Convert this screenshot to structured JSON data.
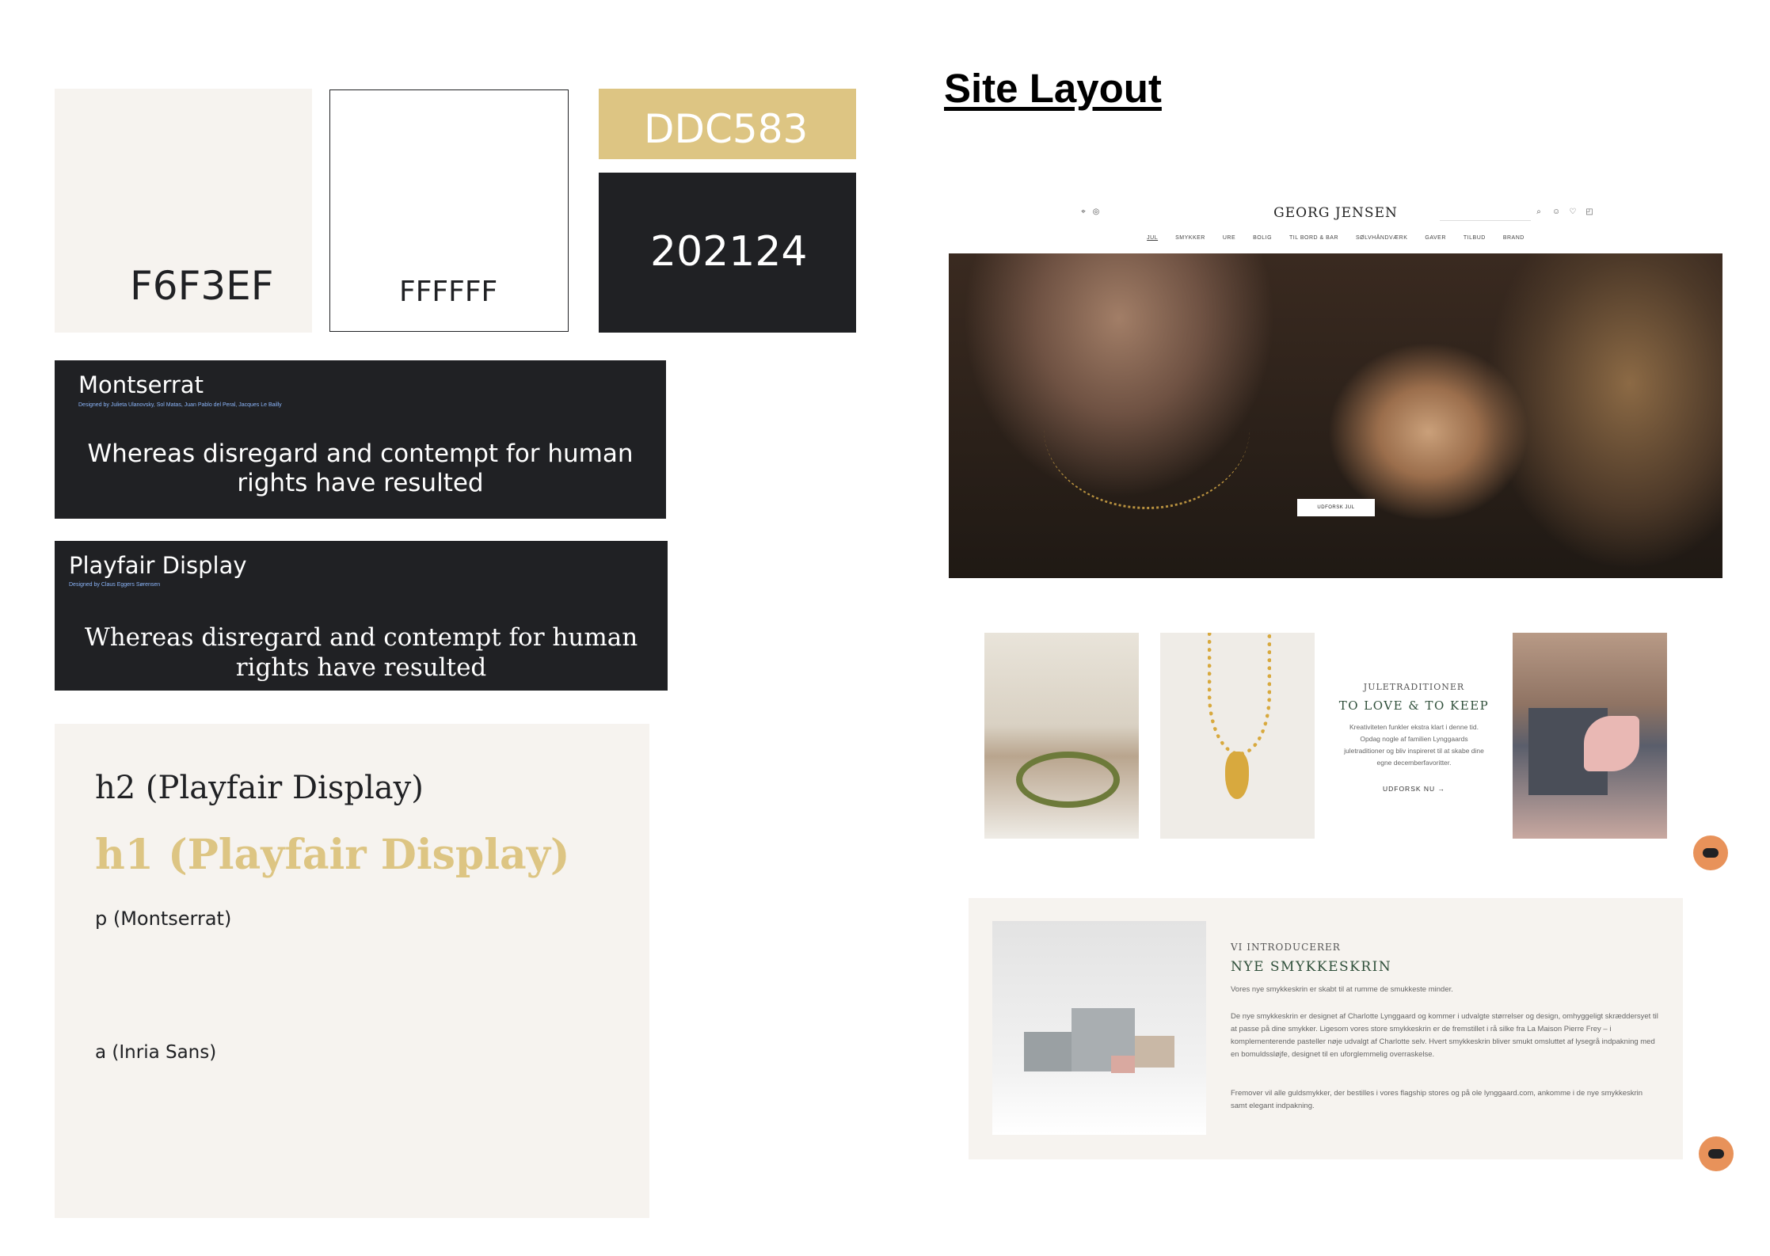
{
  "swatches": [
    {
      "hex": "F6F3EF",
      "color": "#F6F3EF"
    },
    {
      "hex": "FFFFFF",
      "color": "#FFFFFF"
    },
    {
      "hex": "DDC583",
      "color": "#DDC583"
    },
    {
      "hex": "202124",
      "color": "#202124"
    }
  ],
  "fonts": [
    {
      "name": "Montserrat",
      "credit": "Designed by Julieta Ulanovsky, Sol Matas, Juan Pablo del Peral, Jacques Le Bailly",
      "sample": "Whereas disregard and contempt for human rights have resulted"
    },
    {
      "name": "Playfair Display",
      "credit": "Designed by Claus Eggers Sørensen",
      "sample": "Whereas disregard and contempt for human rights have resulted"
    }
  ],
  "type_hierarchy": {
    "h2": "h2 (Playfair Display)",
    "h1": "h1 (Playfair Display)",
    "p": "p (Montserrat)",
    "a": "a (Inria Sans)"
  },
  "site_layout": {
    "title": "Site Layout",
    "header": {
      "logo": "GEORG JENSEN",
      "nav": [
        "JUL",
        "SMYKKER",
        "URE",
        "BOLIG",
        "TIL BORD & BAR",
        "SØLVHÅNDVÆRK",
        "GAVER",
        "TILBUD",
        "BRAND"
      ],
      "icons": [
        "location-icon",
        "account-icon",
        "search-icon",
        "user-icon",
        "heart-icon",
        "bag-icon"
      ]
    },
    "hero": {
      "cta": "UDFORSK JUL"
    },
    "feature": {
      "kicker": "JULETRADITIONER",
      "title": "TO LOVE & TO KEEP",
      "body": "Kreativiteten funkler ekstra klart i denne tid. Opdag nogle af familien Lynggaards juletraditioner og bliv inspireret til at skabe dine egne decemberfavoritter.",
      "cta": "UDFORSK NU →"
    },
    "intro": {
      "kicker": "VI INTRODUCERER",
      "title": "NYE SMYKKESKRIN",
      "lead": "Vores nye smykkeskrin er skabt til at rumme de smukkeste minder.",
      "p1": "De nye smykkeskrin er designet af Charlotte Lynggaard og kommer i udvalgte størrelser og design, omhyggeligt skræddersyet til at passe på dine smykker. Ligesom vores store smykkeskrin er de fremstillet i rå silke fra La Maison Pierre Frey – i komplementerende pasteller nøje udvalgt af Charlotte selv. Hvert smykkeskrin bliver smukt omsluttet af lysegrå indpakning med en bomuldssløjfe, designet til en uforglemmelig overraskelse.",
      "p2": "Fremover vil alle guldsmykker, der bestilles i vores flagship stores og på ole lynggaard.com, ankomme i de nye smykkeskrin samt elegant indpakning."
    }
  }
}
